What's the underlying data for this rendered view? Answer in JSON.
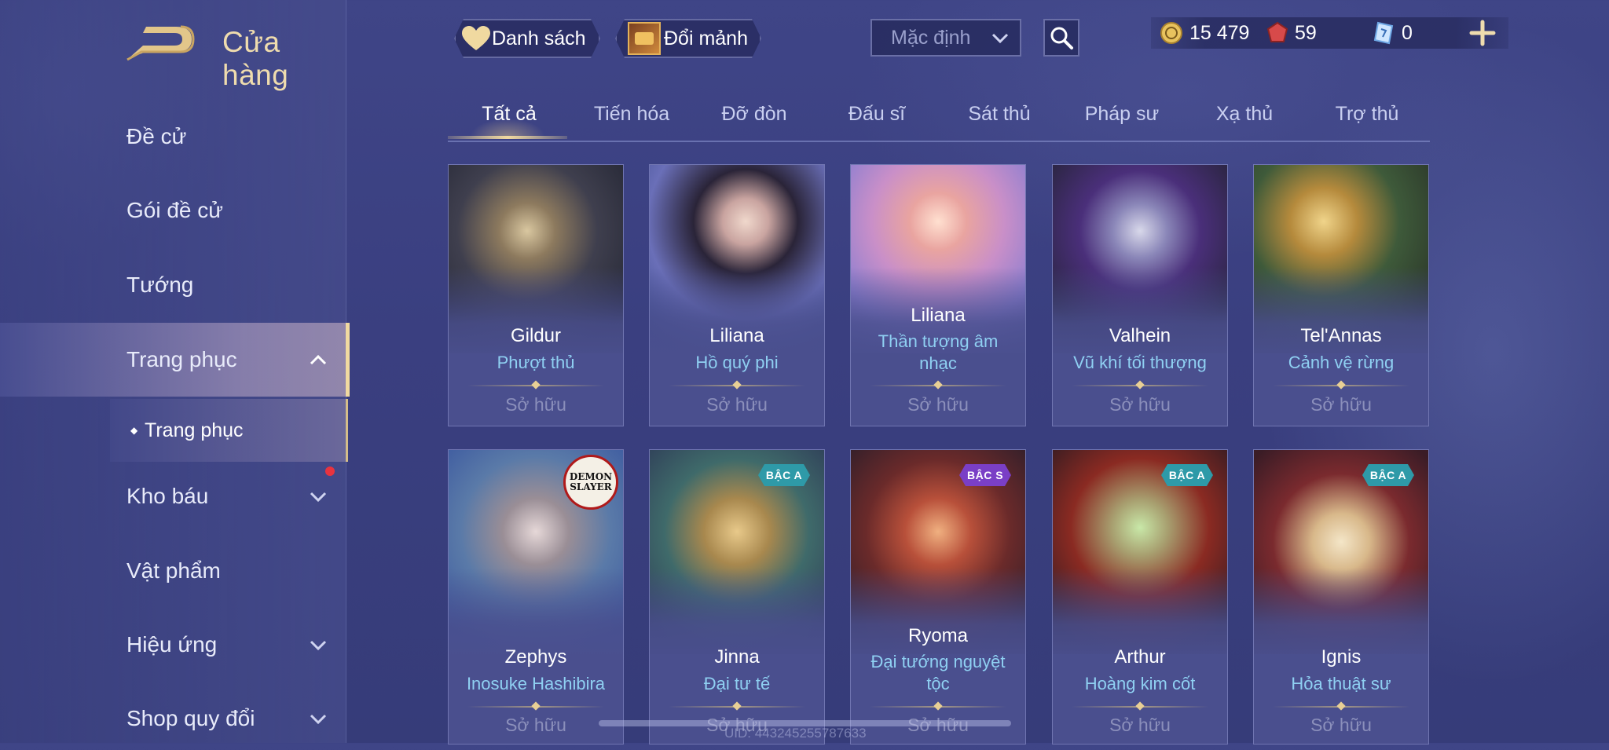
{
  "header": {
    "title": "Cửa hàng",
    "list_button": "Danh sách",
    "exchange_button": "Đổi mảnh",
    "sort_dropdown": "Mặc định"
  },
  "currencies": [
    {
      "icon": "gold-coin-icon",
      "value": "15 479"
    },
    {
      "icon": "ruby-gem-icon",
      "value": "59"
    },
    {
      "icon": "voucher-icon",
      "value": "0"
    }
  ],
  "sidebar": {
    "items": [
      {
        "label": "Đề cử"
      },
      {
        "label": "Gói đề cử"
      },
      {
        "label": "Tướng"
      },
      {
        "label": "Trang phục"
      },
      {
        "label": "Kho báu"
      },
      {
        "label": "Vật phẩm"
      },
      {
        "label": "Hiệu ứng"
      },
      {
        "label": "Shop quy đổi"
      }
    ],
    "sub_item": "Trang phục"
  },
  "tabs": [
    "Tất cả",
    "Tiến hóa",
    "Đỡ đòn",
    "Đấu sĩ",
    "Sát thủ",
    "Pháp sư",
    "Xạ thủ",
    "Trợ thủ"
  ],
  "cards": [
    {
      "hero": "Gildur",
      "skin": "Phượt thủ",
      "status": "Sở hữu"
    },
    {
      "hero": "Liliana",
      "skin": "Hồ quý phi",
      "status": "Sở hữu"
    },
    {
      "hero": "Liliana",
      "skin": "Thần tượng âm nhạc",
      "status": "Sở hữu"
    },
    {
      "hero": "Valhein",
      "skin": "Vũ khí tối thượng",
      "status": "Sở hữu"
    },
    {
      "hero": "Tel'Annas",
      "skin": "Cảnh vệ rừng",
      "status": "Sở hữu"
    },
    {
      "hero": "Zephys",
      "skin": "Inosuke Hashibira",
      "status": "Sở hữu",
      "collab": "DEMON SLAYER"
    },
    {
      "hero": "Jinna",
      "skin": "Đại tư tế",
      "status": "Sở hữu",
      "badge": "BẬC A"
    },
    {
      "hero": "Ryoma",
      "skin": "Đại tướng nguyệt tộc",
      "status": "Sở hữu",
      "badge": "BẬC S"
    },
    {
      "hero": "Arthur",
      "skin": "Hoàng kim cốt",
      "status": "Sở hữu",
      "badge": "BẬC A"
    },
    {
      "hero": "Ignis",
      "skin": "Hỏa thuật sư",
      "status": "Sở hữu",
      "badge": "BẬC A"
    }
  ],
  "footer": {
    "uid": "UID: 443245255787633"
  },
  "colors": {
    "accent_gold": "#efdcae",
    "skin_name": "#8fd0f2",
    "badge_a": "#2e9aa8",
    "badge_s": "#7a3fc6",
    "notice": "#e8333f"
  }
}
